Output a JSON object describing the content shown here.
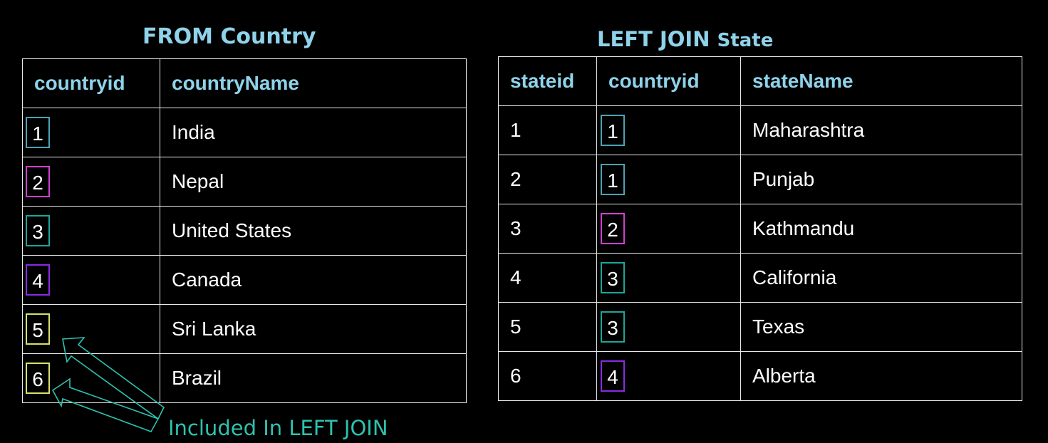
{
  "left_title": "FROM Country",
  "right_title": {
    "main": "LEFT JOIN",
    "table": "State"
  },
  "country_table": {
    "headers": [
      "countryid",
      "countryName"
    ],
    "rows": [
      {
        "id": "1",
        "name": "India",
        "color": "#4aa3b4"
      },
      {
        "id": "2",
        "name": "Nepal",
        "color": "#d23fd1"
      },
      {
        "id": "3",
        "name": "United States",
        "color": "#1fa59a"
      },
      {
        "id": "4",
        "name": "Canada",
        "color": "#8a2be2"
      },
      {
        "id": "5",
        "name": "Sri Lanka",
        "color": "#d6e06a"
      },
      {
        "id": "6",
        "name": "Brazil",
        "color": "#d6e06a"
      }
    ]
  },
  "state_table": {
    "headers": [
      "stateid",
      "countryid",
      "stateName"
    ],
    "rows": [
      {
        "stateid": "1",
        "countryid": "1",
        "name": "Maharashtra",
        "color": "#4aa3b4"
      },
      {
        "stateid": "2",
        "countryid": "1",
        "name": "Punjab",
        "color": "#4aa3b4"
      },
      {
        "stateid": "3",
        "countryid": "2",
        "name": "Kathmandu",
        "color": "#d23fd1"
      },
      {
        "stateid": "4",
        "countryid": "3",
        "name": "California",
        "color": "#1fa59a"
      },
      {
        "stateid": "5",
        "countryid": "3",
        "name": "Texas",
        "color": "#1fa59a"
      },
      {
        "stateid": "6",
        "countryid": "4",
        "name": "Alberta",
        "color": "#8a2be2"
      }
    ]
  },
  "annotation": "Included In LEFT JOIN",
  "colors": {
    "title": "#8fd3ea",
    "annotation": "#2ec2b0",
    "grid": "#e8e8e8",
    "background": "#000000"
  }
}
